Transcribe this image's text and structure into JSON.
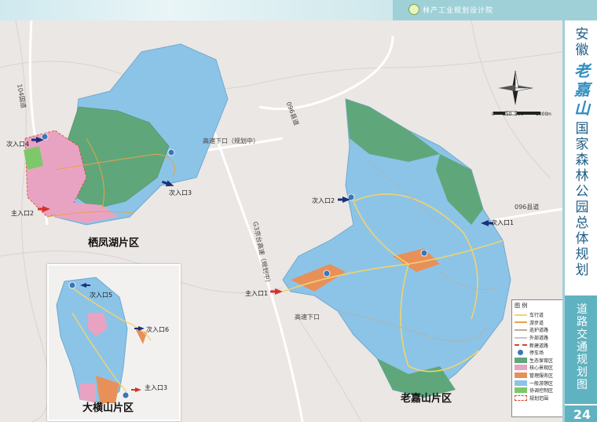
{
  "header": {
    "org": "林产工业规划设计院"
  },
  "title": {
    "prefix": "安徽",
    "fancy": "老嘉山",
    "suffix": "国家森林公园总体规划"
  },
  "subtitle": "道路交通规划图",
  "page_number": "24",
  "map": {
    "areas": [
      {
        "name": "栖凤湖片区"
      },
      {
        "name": "老嘉山片区"
      },
      {
        "name": "大横山片区"
      }
    ],
    "labels": {
      "entry_main_2": "主入口2",
      "entry_sec_4": "次入口4",
      "entry_sec_3_a": "次入口3",
      "entry_sec_2": "次入口2",
      "entry_sec_1": "次入口1",
      "entry_main_1": "主入口1",
      "entry_sec_5": "次入口5",
      "entry_sec_6": "次入口6",
      "entry_main_3": "主入口3",
      "highway_exit_planned": "高速下口（规划中）",
      "highway_exit": "高速下口",
      "road_104": "104国道",
      "road_096_a": "096县道",
      "road_096_b": "096县道",
      "road_g3": "G3京台高速（规划中）"
    },
    "scale": {
      "ticks": [
        "0",
        "250",
        "500",
        "1000"
      ],
      "unit": "m"
    }
  },
  "legend": {
    "title": "图 例",
    "items": [
      {
        "label": "车行道",
        "color": "#f2d36b",
        "kind": "line"
      },
      {
        "label": "游步道",
        "color": "#e7a24a",
        "kind": "line"
      },
      {
        "label": "巡护道路",
        "color": "#b5b09a",
        "kind": "line"
      },
      {
        "label": "外部道路",
        "color": "#c9c4c1",
        "kind": "line"
      },
      {
        "label": "新建道路",
        "color": "#d8462f",
        "kind": "dash"
      },
      {
        "label": "停车场",
        "color": "#3a77b8",
        "kind": "circle"
      },
      {
        "label": "生态保育区",
        "color": "#5fa77a",
        "kind": "fill"
      },
      {
        "label": "核心景观区",
        "color": "#e9a3c2",
        "kind": "fill"
      },
      {
        "label": "管理服务区",
        "color": "#e8905a",
        "kind": "fill"
      },
      {
        "label": "一般游憩区",
        "color": "#8cc4e8",
        "kind": "fill"
      },
      {
        "label": "协调控制区",
        "color": "#7cc86a",
        "kind": "fill"
      },
      {
        "label": "规划范围",
        "color": "#d8462f",
        "kind": "border"
      }
    ]
  }
}
